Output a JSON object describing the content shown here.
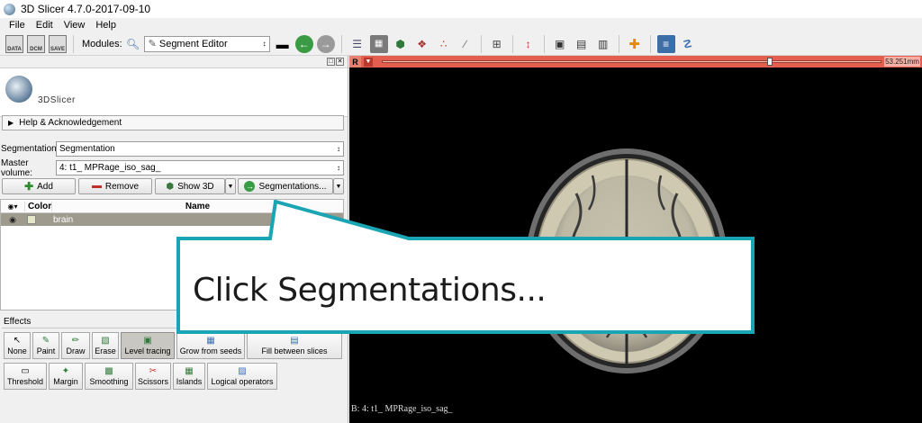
{
  "window": {
    "title": "3D Slicer 4.7.0-2017-09-10"
  },
  "menu": [
    "File",
    "Edit",
    "View",
    "Help"
  ],
  "toolbar": {
    "data_label": "DATA",
    "dcm_label": "DCM",
    "save_label": "SAVE",
    "modules_label": "Modules:",
    "module_selected": "Segment Editor"
  },
  "logo": {
    "text": "3DSlicer"
  },
  "help": {
    "label": "Help & Acknowledgement"
  },
  "form": {
    "segmentation_label": "Segmentation:",
    "segmentation_value": "Segmentation",
    "master_label": "Master volume:",
    "master_value": "4: t1_ MPRage_iso_sag_"
  },
  "buttons": {
    "add": "Add",
    "remove": "Remove",
    "show3d": "Show 3D",
    "segmentations": "Segmentations..."
  },
  "table": {
    "headers": {
      "color": "Color",
      "name": "Name"
    },
    "rows": [
      {
        "name": "brain",
        "color": "#e6e6c8"
      }
    ]
  },
  "effects": {
    "title": "Effects",
    "row1": [
      "None",
      "Paint",
      "Draw",
      "Erase",
      "Level tracing",
      "Grow from seeds",
      "Fill between slices"
    ],
    "row2": [
      "Threshold",
      "Margin",
      "Smoothing",
      "Scissors",
      "Islands",
      "Logical operators"
    ],
    "active": "Level tracing"
  },
  "viewer": {
    "slice_letter": "R",
    "offset": "53.251mm",
    "slider_fraction": 0.78,
    "caption": "B: 4: t1_ MPRage_iso_sag_"
  },
  "callout": {
    "text": "Click Segmentations..."
  },
  "colors": {
    "slice_bar": "#e35e4f",
    "callout_border": "#1aa5b4",
    "selected_row": "#9e9a8e"
  }
}
